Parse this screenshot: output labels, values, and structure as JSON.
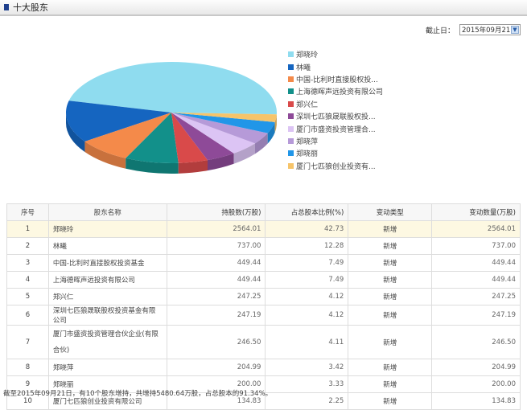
{
  "header": {
    "title": "十大股东"
  },
  "date_filter": {
    "label": "截止日：",
    "value": "2015年09月21日"
  },
  "colors": [
    "#8fdcef",
    "#1565c0",
    "#f48a4a",
    "#12908a",
    "#d94a4a",
    "#8e4a98",
    "#dcc4f4",
    "#b69ad8",
    "#2196e8",
    "#f6c46a"
  ],
  "chart_data": {
    "type": "pie",
    "categories": [
      "郑晓玲",
      "林曦",
      "中国-比利时直接股权投...",
      "上海德晖声远投资有限公司",
      "郑兴仁",
      "深圳七匹狼晟联股权投...",
      "厦门市盛资投资管理合...",
      "郑晓萍",
      "郑晓丽",
      "厦门七匹狼创业投资有..."
    ],
    "values": [
      42.73,
      12.28,
      7.49,
      7.49,
      4.12,
      4.12,
      4.11,
      3.42,
      3.33,
      2.25
    ],
    "legend": "right"
  },
  "table": {
    "headers": [
      "序号",
      "股东名称",
      "持股数(万股)",
      "占总股本比例(%)",
      "变动类型",
      "变动数量(万股)"
    ],
    "rows": [
      [
        "1",
        "郑晓玲",
        "2564.01",
        "42.73",
        "新增",
        "2564.01"
      ],
      [
        "2",
        "林曦",
        "737.00",
        "12.28",
        "新增",
        "737.00"
      ],
      [
        "3",
        "中国-比利时直接股权投资基金",
        "449.44",
        "7.49",
        "新增",
        "449.44"
      ],
      [
        "4",
        "上海德晖声远投资有限公司",
        "449.44",
        "7.49",
        "新增",
        "449.44"
      ],
      [
        "5",
        "郑兴仁",
        "247.25",
        "4.12",
        "新增",
        "247.25"
      ],
      [
        "6",
        "深圳七匹狼晟联股权投资基金有限公司",
        "247.19",
        "4.12",
        "新增",
        "247.19"
      ],
      [
        "7",
        "厦门市盛资投资管理合伙企业(有限合伙)",
        "246.50",
        "4.11",
        "新增",
        "246.50"
      ],
      [
        "8",
        "郑晓萍",
        "204.99",
        "3.42",
        "新增",
        "204.99"
      ],
      [
        "9",
        "郑晓丽",
        "200.00",
        "3.33",
        "新增",
        "200.00"
      ],
      [
        "10",
        "厦门七匹狼创业投资有限公司",
        "134.83",
        "2.25",
        "新增",
        "134.83"
      ]
    ]
  },
  "footer": "截至2015年09月21日，有10个股东增持，共增持5480.64万股，占总股本的91.34%。"
}
